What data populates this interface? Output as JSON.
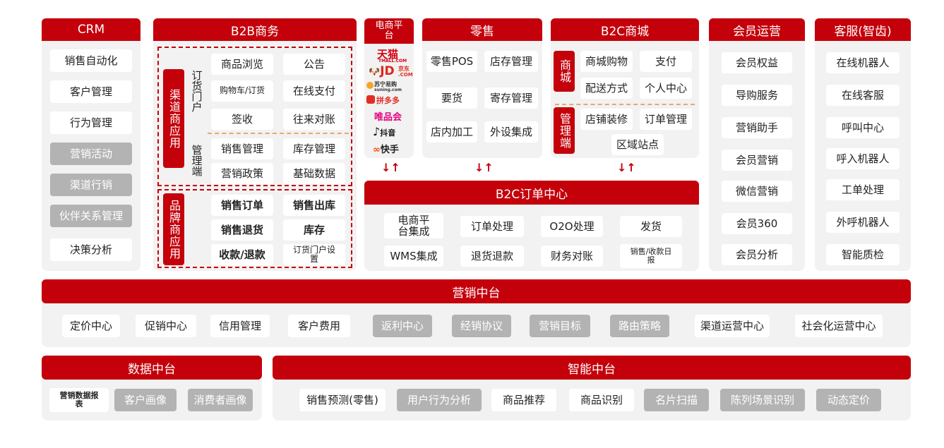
{
  "colors": {
    "brand_red": "#c4000b",
    "panel_bg": "#f2f2f2",
    "grey_chip": "#b3b3b3",
    "dash_orange": "#e9a868"
  },
  "crm": {
    "title": "CRM",
    "items": [
      "销售自动化",
      "客户管理",
      "行为管理",
      "营销活动",
      "渠道行销",
      "伙伴关系管理",
      "决策分析"
    ]
  },
  "b2b": {
    "title": "B2B商务",
    "channel_app": "渠道商应用",
    "order_portal": "订货门户",
    "mgmt_end": "管理端",
    "portal_items": [
      "商品浏览",
      "公告",
      "购物车/订货",
      "在线支付",
      "签收",
      "往来对账"
    ],
    "mgmt_items": [
      "销售管理",
      "库存管理",
      "营销政策",
      "基础数据"
    ],
    "brand_app": "品牌商应用",
    "brand_items": [
      "销售订单",
      "销售出库",
      "销售退货",
      "库存",
      "收款/退款",
      "订货门户设置"
    ]
  },
  "ecom": {
    "title": "电商平台",
    "logos": [
      "天猫",
      "TMALL.COM",
      "JD",
      "京东",
      ".COM",
      "苏宁易购",
      "suning.com",
      "拼多多",
      "唯品会",
      "抖音",
      "快手"
    ]
  },
  "retail": {
    "title": "零售",
    "items": [
      "零售POS",
      "店存管理",
      "要货",
      "寄存管理",
      "店内加工",
      "外设集成"
    ]
  },
  "b2c": {
    "title": "B2C商城",
    "mall": "商城",
    "mall_items": [
      "商城购物",
      "支付",
      "配送方式",
      "个人中心"
    ],
    "mgmt": "管理端",
    "mgmt_items": [
      "店铺装修",
      "订单管理",
      "区域站点"
    ]
  },
  "order_center": {
    "title": "B2C订单中心",
    "items": [
      "电商平台集成",
      "订单处理",
      "O2O处理",
      "发货",
      "WMS集成",
      "退货退款",
      "财务对账",
      "销售/收款日报"
    ]
  },
  "member": {
    "title": "会员运营",
    "items": [
      "会员权益",
      "导购服务",
      "营销助手",
      "会员营销",
      "微信营销",
      "会员360",
      "会员分析"
    ]
  },
  "service": {
    "title": "客服(智齿)",
    "items": [
      "在线机器人",
      "在线客服",
      "呼叫中心",
      "呼入机器人",
      "工单处理",
      "外呼机器人",
      "智能质检"
    ]
  },
  "marketing": {
    "title": "营销中台",
    "items": [
      "定价中心",
      "促销中心",
      "信用管理",
      "客户费用",
      "返利中心",
      "经销协议",
      "营销目标",
      "路由策略",
      "渠道运营中心",
      "社会化运营中心"
    ]
  },
  "data": {
    "title": "数据中台",
    "items": [
      "营销数据报表",
      "客户画像",
      "消费者画像"
    ]
  },
  "ai": {
    "title": "智能中台",
    "items": [
      "销售预测(零售)",
      "用户行为分析",
      "商品推荐",
      "商品识别",
      "名片扫描",
      "陈列场景识别",
      "动态定价"
    ]
  },
  "arrows": "↓↑"
}
